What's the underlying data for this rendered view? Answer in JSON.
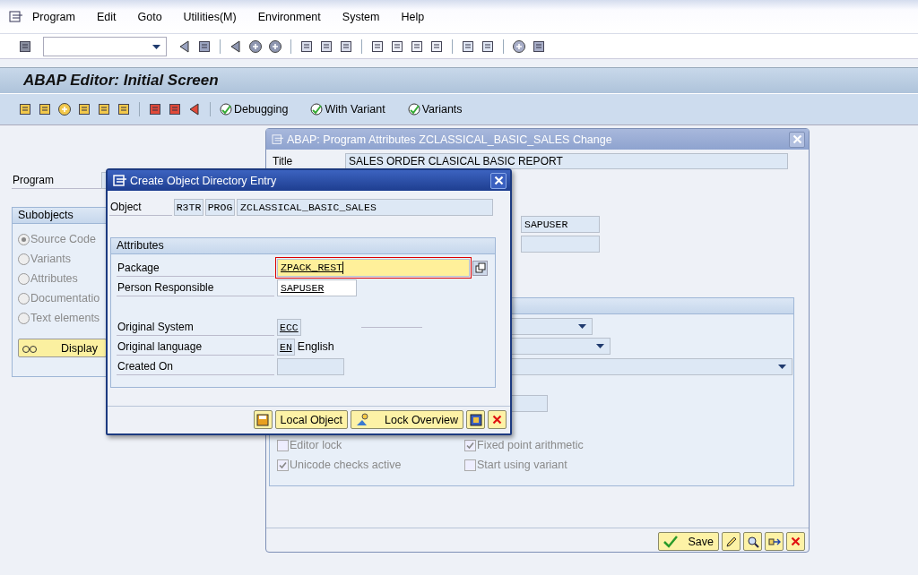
{
  "menu_bar": {
    "items": [
      "Program",
      "Edit",
      "Goto",
      "Utilities(M)",
      "Environment",
      "System",
      "Help"
    ]
  },
  "screen": {
    "title": "ABAP Editor: Initial Screen",
    "app_toolbar": {
      "buttons": [
        "Debugging",
        "With Variant",
        "Variants"
      ]
    },
    "program_label": "Program",
    "subobjects": {
      "title": "Subobjects",
      "options": [
        {
          "label": "Source Code",
          "selected": true,
          "disabled": true
        },
        {
          "label": "Variants",
          "selected": false,
          "disabled": true
        },
        {
          "label": "Attributes",
          "selected": false,
          "disabled": true
        },
        {
          "label": "Documentatio",
          "selected": false,
          "disabled": true
        },
        {
          "label": "Text elements",
          "selected": false,
          "disabled": true
        }
      ],
      "display_button": "Display"
    }
  },
  "attributes_dialog": {
    "title": "ABAP: Program Attributes ZCLASSICAL_BASIC_SALES Change",
    "title_label": "Title",
    "title_value": "SALES ORDER CLASICAL BASIC REPORT",
    "author_value": "SAPUSER",
    "checkboxes": [
      {
        "label": "Editor lock",
        "checked": false,
        "disabled": true
      },
      {
        "label": "Fixed point arithmetic",
        "checked": true,
        "disabled": true
      },
      {
        "label": "Unicode checks active",
        "checked": true,
        "disabled": true
      },
      {
        "label": "Start using variant",
        "checked": false,
        "disabled": true
      }
    ],
    "save_button": "Save"
  },
  "object_dialog": {
    "title": "Create Object Directory Entry",
    "object_label": "Object",
    "object_fields": [
      "R3TR",
      "PROG",
      "ZCLASSICAL_BASIC_SALES"
    ],
    "group_title": "Attributes",
    "rows": [
      {
        "label": "Package",
        "value": "ZPACK_REST",
        "kind": "required"
      },
      {
        "label": "Person Responsible",
        "value": "SAPUSER",
        "kind": "input"
      },
      {
        "label": "Original System",
        "value": "ECC",
        "kind": "display"
      },
      {
        "label": "Original language",
        "value": "EN",
        "description": "English",
        "kind": "display"
      },
      {
        "label": "Created On",
        "kind": "empty"
      }
    ],
    "buttons": [
      "Local Object",
      "Lock Overview"
    ]
  }
}
